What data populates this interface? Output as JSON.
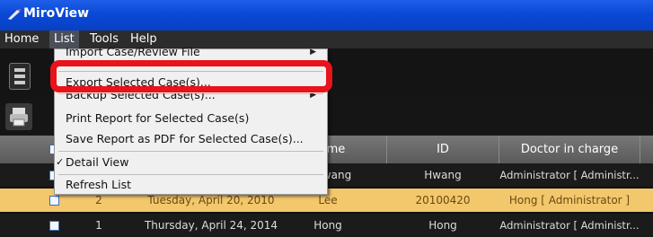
{
  "window": {
    "title": "MiroView"
  },
  "menu": {
    "items": [
      "Home",
      "List",
      "Tools",
      "Help"
    ]
  },
  "dropdown": {
    "items": [
      {
        "label": "Import Case/Review File",
        "submenu": true
      },
      {
        "label": "Export Selected Case(s)..."
      },
      {
        "label": "Backup Selected Case(s)...",
        "submenu": true
      },
      {
        "label": "Print Report for Selected Case(s)"
      },
      {
        "label": "Save Report as PDF for Selected Case(s)..."
      },
      {
        "label": "Detail View",
        "checked": true,
        "checkmark": "✓"
      },
      {
        "label": "Refresh List"
      }
    ]
  },
  "table": {
    "headers": [
      "ame",
      "ID",
      "Doctor in charge"
    ],
    "rows": [
      {
        "no": "",
        "date": "",
        "name": "wang",
        "id": "Hwang",
        "doctor": "Administrator [ Administr...",
        "selected": false
      },
      {
        "no": "2",
        "date": "Tuesday, April 20, 2010",
        "name": "Lee",
        "id": "20100420",
        "doctor": "Hong [ Administrator ]",
        "selected": true
      },
      {
        "no": "1",
        "date": "Thursday, April 24, 2014",
        "name": "Hong",
        "id": "Hong",
        "doctor": "Administrator [ Administr...",
        "selected": false
      }
    ]
  },
  "colors": {
    "highlight": "#e8131b",
    "selected_row": "#f3c76c",
    "titlebar": "#0a49d6"
  }
}
